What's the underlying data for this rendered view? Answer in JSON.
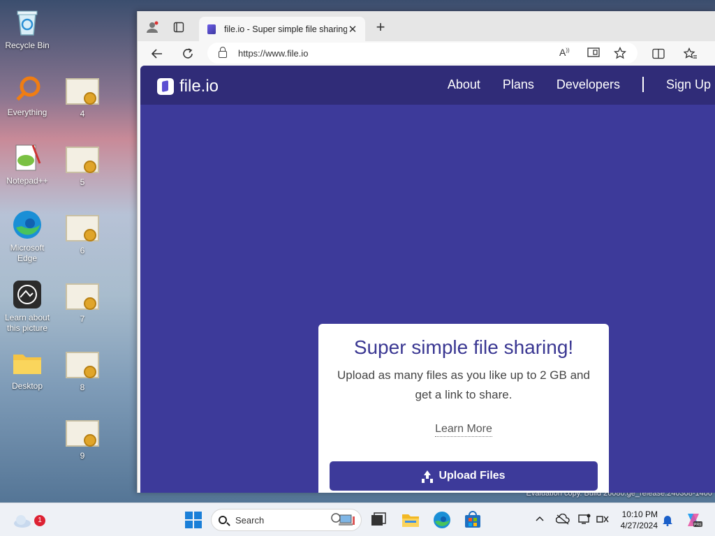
{
  "desktop": {
    "icons": [
      {
        "label": "Recycle Bin",
        "icon": "recycle-bin-icon"
      },
      {
        "label": "Everything",
        "icon": "search-magnifier-icon"
      },
      {
        "label": "Notepad++",
        "icon": "notepadpp-icon"
      },
      {
        "label": "Microsoft Edge",
        "icon": "edge-icon"
      },
      {
        "label": "Learn about this picture",
        "icon": "camera-icon"
      },
      {
        "label": "Desktop",
        "icon": "folder-icon"
      }
    ],
    "cert_files": [
      "4",
      "5",
      "6",
      "7",
      "8",
      "9"
    ],
    "watermark": "Evaluation copy. Build 26080.ge_release.240308-1400"
  },
  "browser": {
    "tab_title": "file.io - Super simple file sharing",
    "address": "https://www.file.io",
    "icons": {
      "profile": "profile-icon",
      "tab_actions": "tab-actions-icon",
      "back": "back-arrow-icon",
      "refresh": "refresh-icon",
      "read_aloud": "read-aloud-icon",
      "app_view": "app-view-icon",
      "favorite": "star-icon",
      "split_screen": "split-screen-icon",
      "favorites": "favorites-icon"
    }
  },
  "site": {
    "logo_text": "file.io",
    "nav": {
      "about": "About",
      "plans": "Plans",
      "developers": "Developers",
      "signup": "Sign Up"
    },
    "card": {
      "headline": "Super simple file sharing!",
      "subtext": "Upload as many files as you like up to 2 GB and get a link to share.",
      "learn_more": "Learn More",
      "upload_button": "Upload Files"
    },
    "colors": {
      "brand": "#3d3a9a",
      "header": "#302c78"
    }
  },
  "taskbar": {
    "search_placeholder": "Search",
    "weather_badge": "1",
    "time": "10:10 PM",
    "date": "4/27/2024",
    "icons": [
      "start-icon",
      "task-view-icon",
      "file-explorer-icon",
      "edge-icon",
      "store-icon"
    ]
  }
}
